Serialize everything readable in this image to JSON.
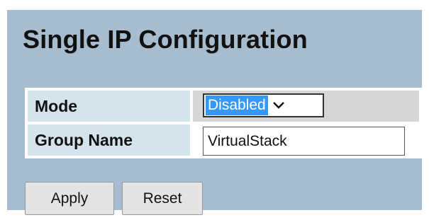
{
  "page": {
    "title": "Single IP Configuration"
  },
  "form": {
    "mode": {
      "label": "Mode",
      "selected": "Disabled"
    },
    "group_name": {
      "label": "Group Name",
      "value": "VirtualStack"
    }
  },
  "buttons": {
    "apply": "Apply",
    "reset": "Reset"
  },
  "icons": {
    "dropdown": "chevron-down-icon"
  },
  "colors": {
    "panel_background": "#a8bccf",
    "label_cell_background": "#d5e3ec",
    "selection_highlight": "#3399ff"
  }
}
